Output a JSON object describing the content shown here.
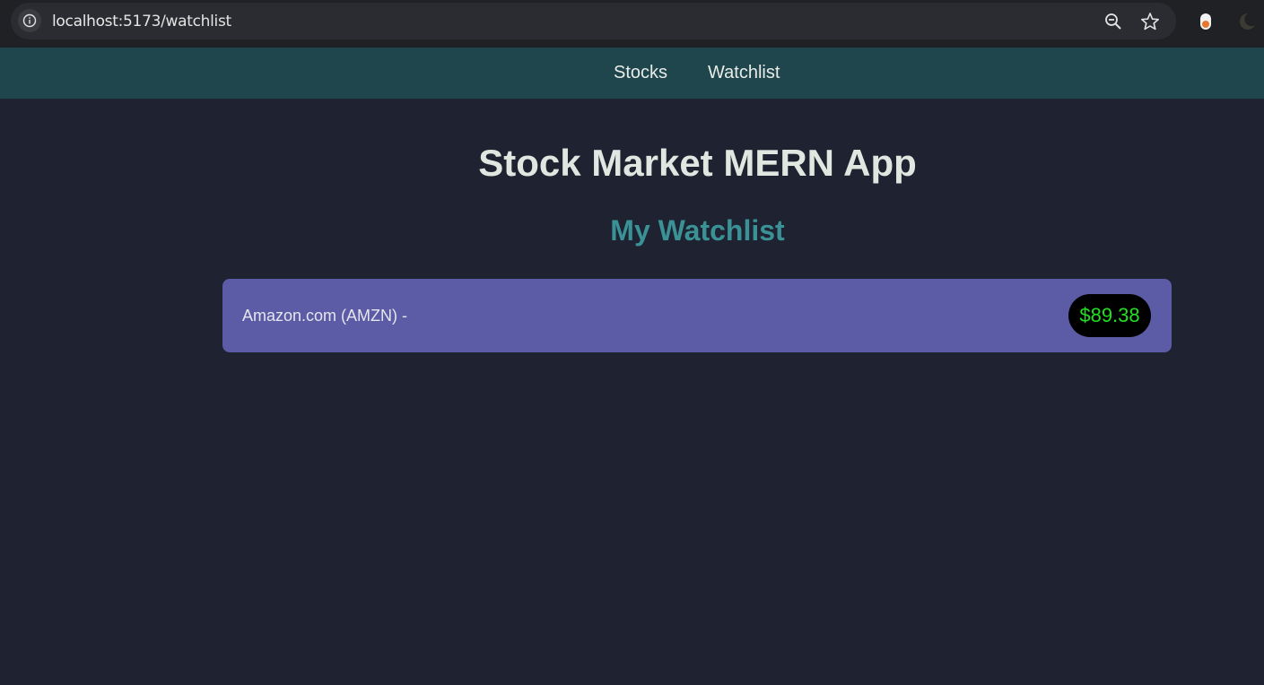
{
  "browser": {
    "url_host": "localhost",
    "url_path": ":5173/watchlist",
    "icons": [
      "info-icon",
      "zoom-out-icon",
      "star-icon",
      "extension-icon",
      "moon-icon"
    ]
  },
  "nav": {
    "items": [
      {
        "label": "Stocks"
      },
      {
        "label": "Watchlist"
      }
    ]
  },
  "main": {
    "title": "Stock Market MERN App",
    "section_title": "My Watchlist",
    "watchlist": [
      {
        "name": "Amazon.com (AMZN) -",
        "price": "$89.38"
      }
    ]
  },
  "colors": {
    "background": "#1f2230",
    "navbar": "#20464d",
    "section_title": "#3a9296",
    "card": "#5b5ba6",
    "price_text": "#22e022"
  }
}
